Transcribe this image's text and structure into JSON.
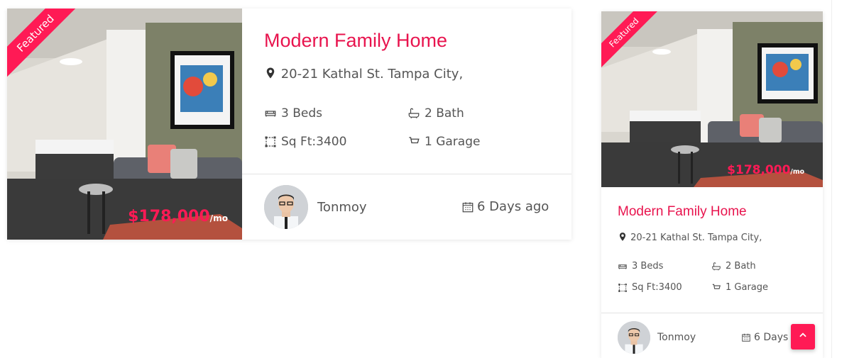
{
  "colors": {
    "accent": "#ff1a55",
    "title": "#e8144e",
    "text": "#555555"
  },
  "listings": [
    {
      "badge": "Featured",
      "price": "$178,000",
      "price_unit": "/mo",
      "title": "Modern Family Home",
      "address": "20-21 Kathal St. Tampa City,",
      "beds": "3 Beds",
      "bath": "2 Bath",
      "area": "Sq Ft:3400",
      "garage": "1 Garage",
      "agent": "Tonmoy",
      "posted": "6 Days ago"
    },
    {
      "badge": "Featured",
      "price": "$178,000",
      "price_unit": "/mo",
      "title": "Modern Family Home",
      "address": "20-21 Kathal St. Tampa City,",
      "beds": "3 Beds",
      "bath": "2 Bath",
      "area": "Sq Ft:3400",
      "garage": "1 Garage",
      "agent": "Tonmoy",
      "posted": "6 Days a"
    }
  ],
  "icons": {
    "address": "map-marker-icon",
    "beds": "bed-icon",
    "bath": "bathtub-icon",
    "area": "area-icon",
    "garage": "garage-icon",
    "posted": "calendar-icon",
    "scroll_top": "chevron-up-icon"
  }
}
